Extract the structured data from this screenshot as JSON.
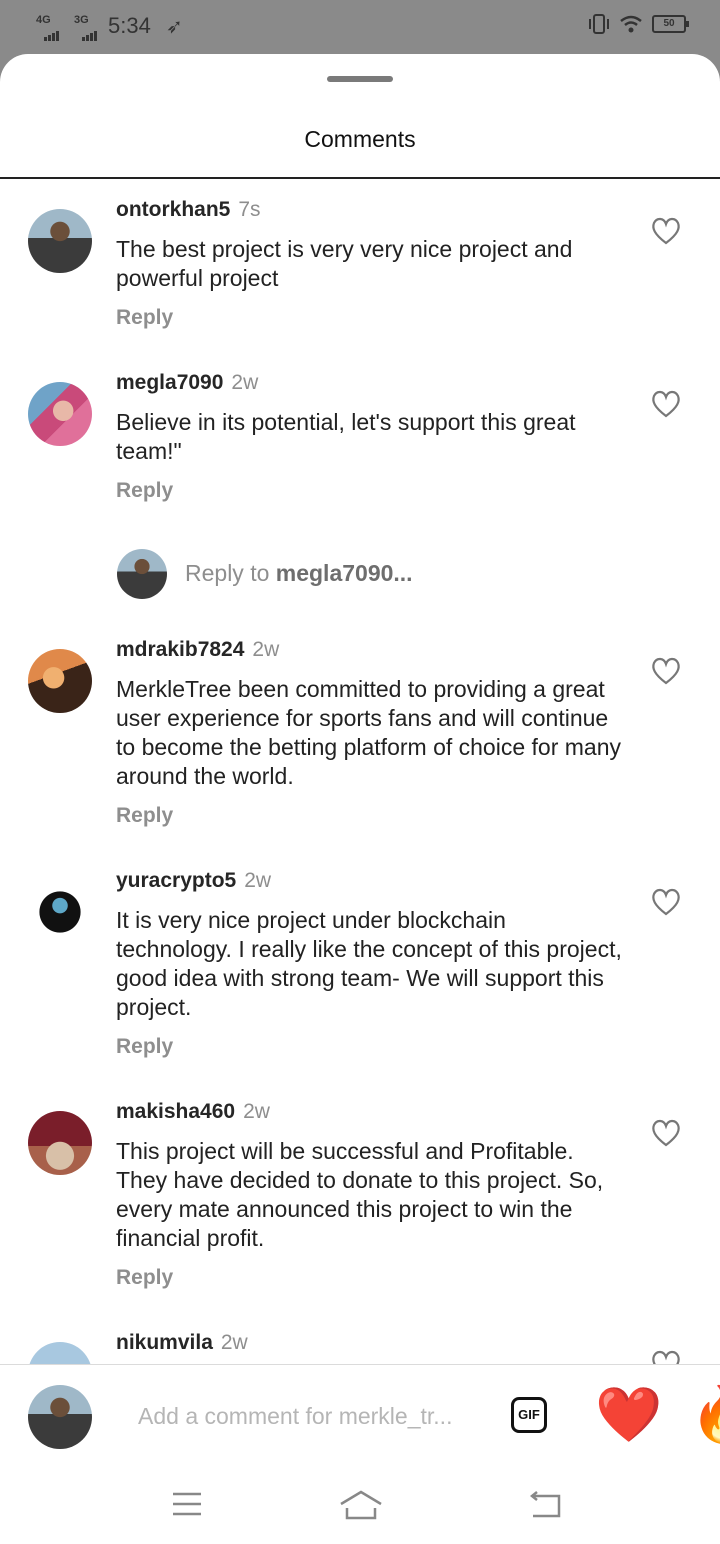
{
  "status_bar": {
    "network1": "4G",
    "network2": "3G",
    "time": "5:34",
    "battery": "50"
  },
  "sheet": {
    "title": "Comments"
  },
  "comments": [
    {
      "username": "ontorkhan5",
      "time": "7s",
      "text": "The best project is very very nice project and powerful project",
      "reply_label": "Reply"
    },
    {
      "username": "megla7090",
      "time": "2w",
      "text": "Believe in its potential, let's support this great team!\"",
      "reply_label": "Reply"
    },
    {
      "username": "mdrakib7824",
      "time": "2w",
      "text": "MerkleTree been committed to providing a great user experience for sports fans and will continue to become the betting platform of choice for many around the world.",
      "reply_label": "Reply"
    },
    {
      "username": "yuracrypto5",
      "time": "2w",
      "text": "It is very nice project under blockchain technology. I really like the concept of this project, good idea with strong team- We will support this project.",
      "reply_label": "Reply"
    },
    {
      "username": "makisha460",
      "time": "2w",
      "text": "This project will be successful and Profitable. They have decided to donate to this project. So, every mate announced this project to win the financial profit.",
      "reply_label": "Reply"
    },
    {
      "username": "nikumvila",
      "time": "2w"
    }
  ],
  "reply_prompt": {
    "prefix": "Reply to ",
    "target": "megla7090..."
  },
  "composer": {
    "placeholder": "Add a comment for merkle_tr...",
    "gif_label": "GIF",
    "emoji1": "❤️",
    "emoji2": "🔥"
  },
  "icons": {
    "heart": "heart-outline-icon",
    "nav_menu": "menu-icon",
    "nav_home": "home-icon",
    "nav_back": "back-icon"
  },
  "colors": {
    "status_bg": "#8a8a8a",
    "muted_text": "#8e8e8e"
  }
}
